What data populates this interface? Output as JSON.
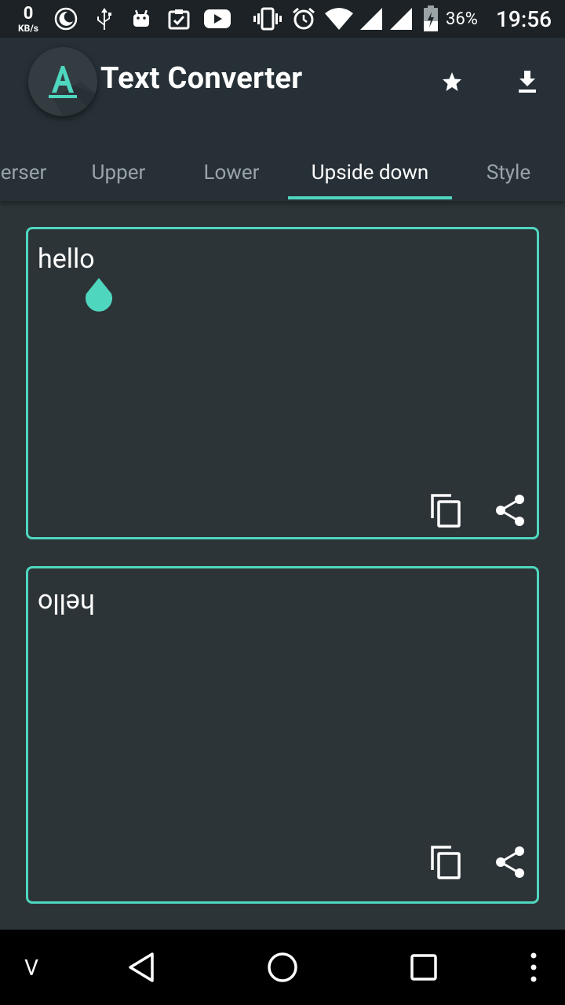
{
  "status_bar": {
    "speed_value": "0",
    "speed_unit": "KB/s",
    "battery_percent": "36%",
    "time": "19:56",
    "icons": [
      "moon-icon",
      "usb-icon",
      "android-icon",
      "clipboard-check-icon",
      "youtube-icon",
      "vibrate-icon",
      "alarm-icon",
      "wifi-icon",
      "signal-icon",
      "signal-icon",
      "battery-icon"
    ]
  },
  "app_bar": {
    "title": "Text Converter",
    "actions": [
      "star-icon",
      "download-icon"
    ]
  },
  "tabs": [
    {
      "label": "erser",
      "active": false
    },
    {
      "label": "Upper",
      "active": false
    },
    {
      "label": "Lower",
      "active": false
    },
    {
      "label": "Upside down",
      "active": true
    },
    {
      "label": "Style",
      "active": false
    }
  ],
  "input_card": {
    "text": "hello"
  },
  "output_card": {
    "text": "hello"
  },
  "nav_bar": {
    "left_label": "V"
  },
  "colors": {
    "accent": "#4fd6bf",
    "background": "#2c3437",
    "app_bar": "#263036",
    "status_bar": "#1c2225",
    "tab_inactive": "#9aa4a8"
  }
}
